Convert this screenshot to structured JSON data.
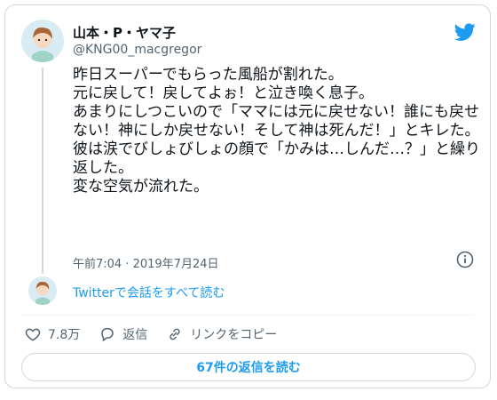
{
  "user": {
    "display_name": "山本・P・ヤマ子",
    "handle": "@KNG00_macgregor"
  },
  "tweet": {
    "text": "昨日スーパーでもらった風船が割れた。\n元に戻して！戻してよぉ！と泣き喚く息子。\nあまりにしつこいので「ママには元に戻せない！誰にも戻せない！神にしか戻せない！そして神は死んだ！」とキレた。\n彼は涙でびしょびしょの顔で「かみは…しんだ…？」と繰り返した。\n変な空気が流れた。",
    "timestamp": "午前7:04 · 2019年7月24日"
  },
  "thread": {
    "read_all_label": "Twitterで会話をすべて読む"
  },
  "actions": {
    "like_count": "7.8万",
    "reply_label": "返信",
    "copy_link_label": "リンクをコピー"
  },
  "replies_button_label": "67件の返信を読む",
  "colors": {
    "accent": "#1d9bf0",
    "border": "#cfd9de",
    "secondary_text": "#536471"
  },
  "icons": [
    "twitter-bird-icon",
    "info-icon",
    "heart-icon",
    "reply-icon",
    "link-icon"
  ]
}
